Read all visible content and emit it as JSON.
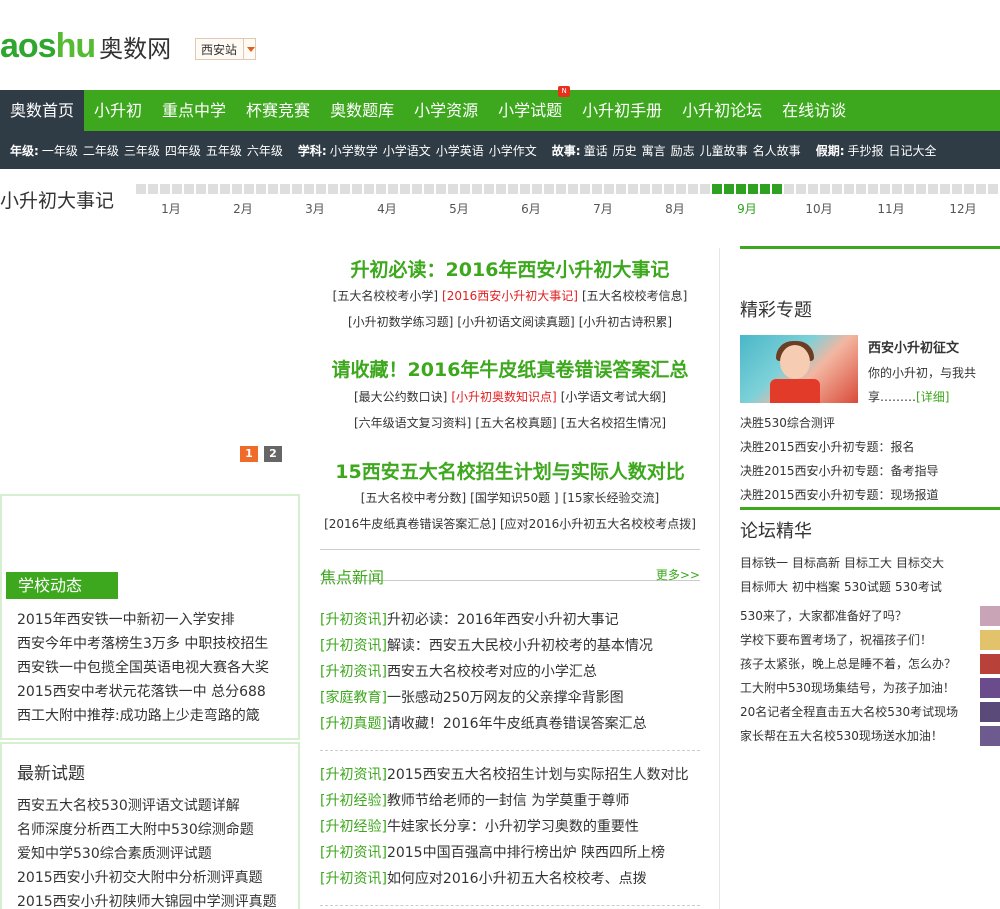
{
  "header": {
    "logo_latin_1": "aos",
    "logo_latin_2": "hu",
    "logo_cn": "奥数网",
    "city": "西安站"
  },
  "nav": [
    {
      "label": "奥数首页",
      "active": true
    },
    {
      "label": "小升初"
    },
    {
      "label": "重点中学"
    },
    {
      "label": "杯赛竞赛"
    },
    {
      "label": "奥数题库"
    },
    {
      "label": "小学资源"
    },
    {
      "label": "小学试题",
      "badge": "N"
    },
    {
      "label": "小升初手册"
    },
    {
      "label": "小升初论坛"
    },
    {
      "label": "在线访谈"
    }
  ],
  "subnav": [
    {
      "label": "年级:",
      "links": [
        "一年级",
        "二年级",
        "三年级",
        "四年级",
        "五年级",
        "六年级"
      ]
    },
    {
      "label": "学科:",
      "links": [
        "小学数学",
        "小学语文",
        "小学英语",
        "小学作文"
      ]
    },
    {
      "label": "故事:",
      "links": [
        "童话",
        "历史",
        "寓言",
        "励志",
        "儿童故事",
        "名人故事"
      ]
    },
    {
      "label": "假期:",
      "links": [
        "手抄报",
        "日记大全"
      ]
    }
  ],
  "timeline": {
    "title": "小升初大事记",
    "months": [
      "1月",
      "2月",
      "3月",
      "4月",
      "5月",
      "6月",
      "7月",
      "8月",
      "9月",
      "10月",
      "11月",
      "12月"
    ],
    "current_month": "9月"
  },
  "slider": {
    "pages": [
      "1",
      "2"
    ],
    "active": "1"
  },
  "headlines": [
    {
      "title": "升初必读：2016年西安小升初大事记",
      "tags": [
        [
          {
            "t": "[五大名校校考小学]"
          },
          {
            "t": "[2016西安小升初大事记]",
            "red": true
          },
          {
            "t": "[五大名校校考信息]"
          }
        ],
        [
          {
            "t": "[小升初数学练习题]"
          },
          {
            "t": "[小升初语文阅读真题]"
          },
          {
            "t": "[小升初古诗积累]"
          }
        ]
      ]
    },
    {
      "title": "请收藏！2016年牛皮纸真卷错误答案汇总",
      "tags": [
        [
          {
            "t": "[最大公约数口诀]"
          },
          {
            "t": "[小升初奥数知识点]",
            "red": true
          },
          {
            "t": "[小学语文考试大纲]"
          }
        ],
        [
          {
            "t": "[六年级语文复习资料]"
          },
          {
            "t": "[五大名校真题]"
          },
          {
            "t": "[五大名校招生情况]"
          }
        ]
      ]
    },
    {
      "title": "15西安五大名校招生计划与实际人数对比",
      "tags": [
        [
          {
            "t": "[五大名校中考分数]"
          },
          {
            "t": "[国学知识50题 ]"
          },
          {
            "t": "[15家长经验交流]"
          }
        ],
        [
          {
            "t": "[2016牛皮纸真卷错误答案汇总]"
          },
          {
            "t": "[应对2016小升初五大名校校考点拨]"
          }
        ]
      ]
    }
  ],
  "school_news": {
    "title": "学校动态",
    "items": [
      "2015年西安铁一中新初一入学安排",
      "西安今年中考落榜生3万多  中职技校招生",
      "西安铁一中包揽全国英语电视大赛各大奖",
      "2015西安中考状元花落铁一中  总分688",
      "西工大附中推荐:成功路上少走弯路的箴"
    ]
  },
  "latest_exams": {
    "title": "最新试题",
    "items": [
      "西安五大名校530测评语文试题详解",
      "名师深度分析西工大附中530综测命题",
      "爱知中学530综合素质测评试题",
      "2015西安小升初交大附中分析测评真题",
      "2015西安小升初陕师大锦园中学测评真题"
    ]
  },
  "focus_news": {
    "title": "焦点新闻",
    "more": "更多>>",
    "group1": [
      {
        "cat": "[升初资讯]",
        "text": "升初必读：2016年西安小升初大事记"
      },
      {
        "cat": "[升初资讯]",
        "text": "解读：西安五大民校小升初校考的基本情况"
      },
      {
        "cat": "[升初资讯]",
        "text": "西安五大名校校考对应的小学汇总"
      },
      {
        "cat": "[家庭教育]",
        "text": "一张感动250万网友的父亲撑伞背影图"
      },
      {
        "cat": "[升初真题]",
        "text": "请收藏！2016年牛皮纸真卷错误答案汇总"
      }
    ],
    "group2": [
      {
        "cat": "[升初资讯]",
        "text": "2015西安五大名校招生计划与实际招生人数对比"
      },
      {
        "cat": "[升初经验]",
        "text": "教师节给老师的一封信 为学莫重于尊师"
      },
      {
        "cat": "[升初经验]",
        "text": "牛娃家长分享：小升初学习奥数的重要性"
      },
      {
        "cat": "[升初资讯]",
        "text": "2015中国百强高中排行榜出炉 陕西四所上榜"
      },
      {
        "cat": "[升初资讯]",
        "text": "如何应对2016小升初五大名校校考、点拨"
      }
    ]
  },
  "topics": {
    "title": "精彩专题",
    "feature_title": "西安小升初征文",
    "feature_desc": "你的小升初，与我共享………",
    "detail": "[详细]",
    "items": [
      "决胜530综合测评",
      "决胜2015西安小升初专题：报名",
      "决胜2015西安小升初专题：备考指导",
      "决胜2015西安小升初专题：现场报道"
    ]
  },
  "forum": {
    "title": "论坛精华",
    "tags": [
      "目标铁一",
      "目标高新",
      "目标工大",
      "目标交大",
      "目标师大",
      "初中档案",
      "530试题",
      "530考试"
    ],
    "items": [
      {
        "text": "530来了，大家都准备好了吗？",
        "avatar": "#c9a3b6"
      },
      {
        "text": "学校下要布置考场了，祝福孩子们！",
        "avatar": "#e2c26b"
      },
      {
        "text": "孩子太紧张，晚上总是睡不着，怎么办？",
        "avatar": "#b8413a"
      },
      {
        "text": "工大附中530现场集结号，为孩子加油！",
        "avatar": "#6a4c8c"
      },
      {
        "text": "20名记者全程直击五大名校530考试现场",
        "avatar": "#5a4a7a"
      },
      {
        "text": "家长帮在五大名校530现场送水加油！",
        "avatar": "#6d5a8e"
      }
    ]
  }
}
